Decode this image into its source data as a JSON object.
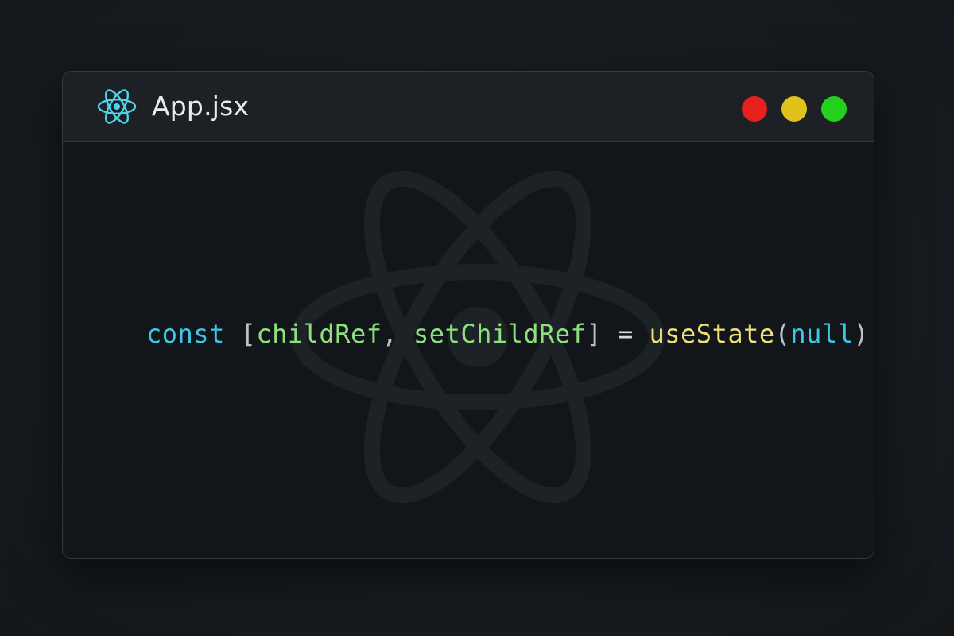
{
  "window": {
    "file_name": "App.jsx",
    "file_icon": "react-icon",
    "controls": [
      {
        "name": "close",
        "color": "#e8201d"
      },
      {
        "name": "minimize",
        "color": "#e1c21a"
      },
      {
        "name": "maximize",
        "color": "#22d01d"
      }
    ]
  },
  "editor": {
    "watermark_icon": "react-logo-watermark",
    "code": {
      "keyword": "const",
      "open_bracket": "[",
      "var1": "childRef",
      "comma": ",",
      "var2": "setChildRef",
      "close_bracket": "]",
      "equals": "=",
      "func": "useState",
      "open_paren": "(",
      "arg": "null",
      "close_paren": ")"
    }
  },
  "colors": {
    "keyword": "#3fc6e6",
    "punctuation": "#b9c0c6",
    "variable": "#8ee07e",
    "function": "#efe07a",
    "literal": "#3fc6e6",
    "react_accent": "#4fd3ea"
  }
}
